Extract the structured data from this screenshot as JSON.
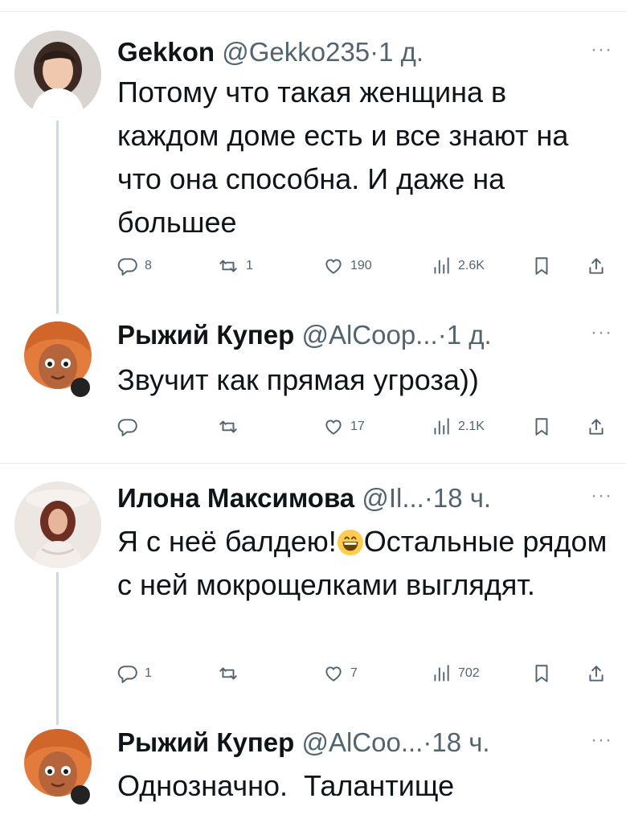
{
  "tweets": [
    {
      "name": "Gekkon",
      "handle": "@Gekko235",
      "time": "1 д.",
      "text": "Потому что такая женщина в каждом доме есть и все знают на что она способна. И даже на большее",
      "replies": "8",
      "retweets": "1",
      "likes": "190",
      "views": "2.6K"
    },
    {
      "name": "Рыжий Купер",
      "handle": "@AlCoop...",
      "time": "1 д.",
      "text": "Звучит как прямая угроза))",
      "replies": "",
      "retweets": "",
      "likes": "17",
      "views": "2.1K"
    },
    {
      "name": "Илона Максимова",
      "handle": "@Il...",
      "time": "18 ч.",
      "text_before_emoji": "Я с неё балдею!",
      "text_after_emoji": "Остальные рядом с ней мокрощелками выглядят.",
      "replies": "1",
      "retweets": "",
      "likes": "7",
      "views": "702"
    },
    {
      "name": "Рыжий Купер",
      "handle": "@AlCoo...",
      "time": "18 ч.",
      "text": "Однозначно.  Талантище"
    }
  ],
  "ui": {
    "separator": "·",
    "more": "···"
  },
  "icons": {
    "reply": "reply-icon",
    "retweet": "retweet-icon",
    "like": "heart-icon",
    "views": "views-icon",
    "bookmark": "bookmark-icon",
    "share": "share-icon",
    "emoji": "grinning-face-emoji"
  },
  "colors": {
    "text": "#0f1419",
    "secondary": "#536471",
    "thread_line": "#cfd9de",
    "divider": "#e6ecf0"
  }
}
